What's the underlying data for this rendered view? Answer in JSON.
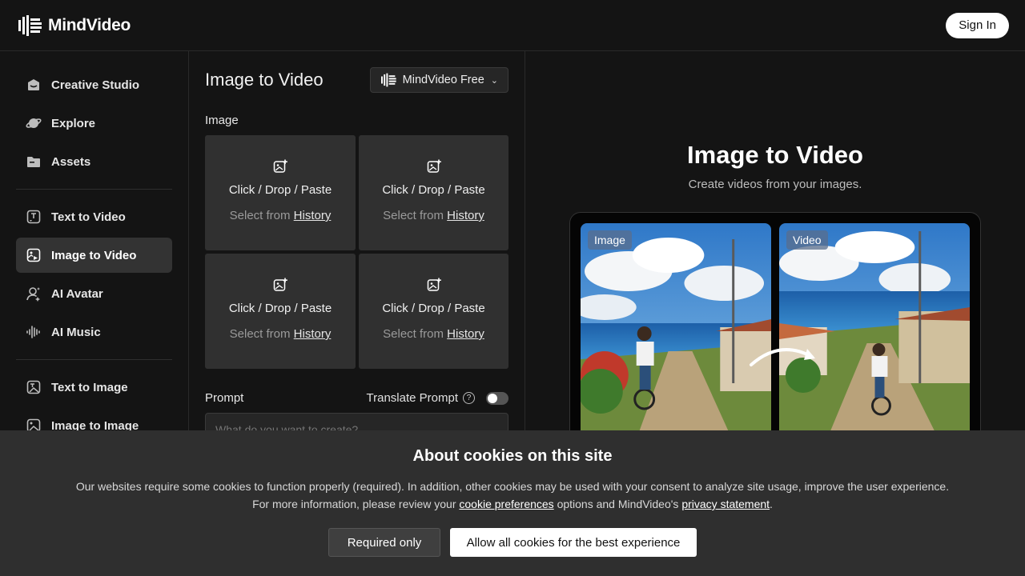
{
  "header": {
    "brand": "MindVideo",
    "sign_in_label": "Sign In"
  },
  "sidebar": {
    "groups": [
      [
        {
          "label": "Creative Studio",
          "icon": "studio-icon"
        },
        {
          "label": "Explore",
          "icon": "planet-icon"
        },
        {
          "label": "Assets",
          "icon": "folder-icon"
        }
      ],
      [
        {
          "label": "Text to Video",
          "icon": "text-video-icon"
        },
        {
          "label": "Image to Video",
          "icon": "image-video-icon",
          "active": true
        },
        {
          "label": "AI Avatar",
          "icon": "avatar-icon"
        },
        {
          "label": "AI Music",
          "icon": "music-icon"
        }
      ],
      [
        {
          "label": "Text to Image",
          "icon": "text-image-icon"
        },
        {
          "label": "Image to Image",
          "icon": "image-image-icon"
        }
      ]
    ]
  },
  "panel": {
    "title": "Image to Video",
    "model": "MindVideo Free",
    "image_label": "Image",
    "slot_main": "Click / Drop / Paste",
    "slot_select_prefix": "Select from",
    "slot_history_link": "History",
    "prompt_label": "Prompt",
    "translate_label": "Translate Prompt",
    "translate_enabled": false,
    "prompt_placeholder": "What do you want to create?"
  },
  "preview": {
    "title": "Image to Video",
    "subtitle": "Create videos from your images.",
    "left_badge": "Image",
    "right_badge": "Video"
  },
  "cookie": {
    "title": "About cookies on this site",
    "line1": "Our websites require some cookies to function properly (required). In addition, other cookies may be used with your consent to analyze site usage, improve the user experience.",
    "line2_prefix": "For more information, please review your",
    "line2_link1": "cookie preferences",
    "line2_middle": "options and MindVideo's",
    "line2_link2": "privacy statement",
    "line2_suffix": ".",
    "required_only_label": "Required only",
    "allow_all_label": "Allow all cookies for the best experience"
  },
  "colors": {
    "background": "#141414",
    "active_nav": "#333333",
    "slot": "#303030",
    "cookie_banner": "#2f2f2f"
  }
}
